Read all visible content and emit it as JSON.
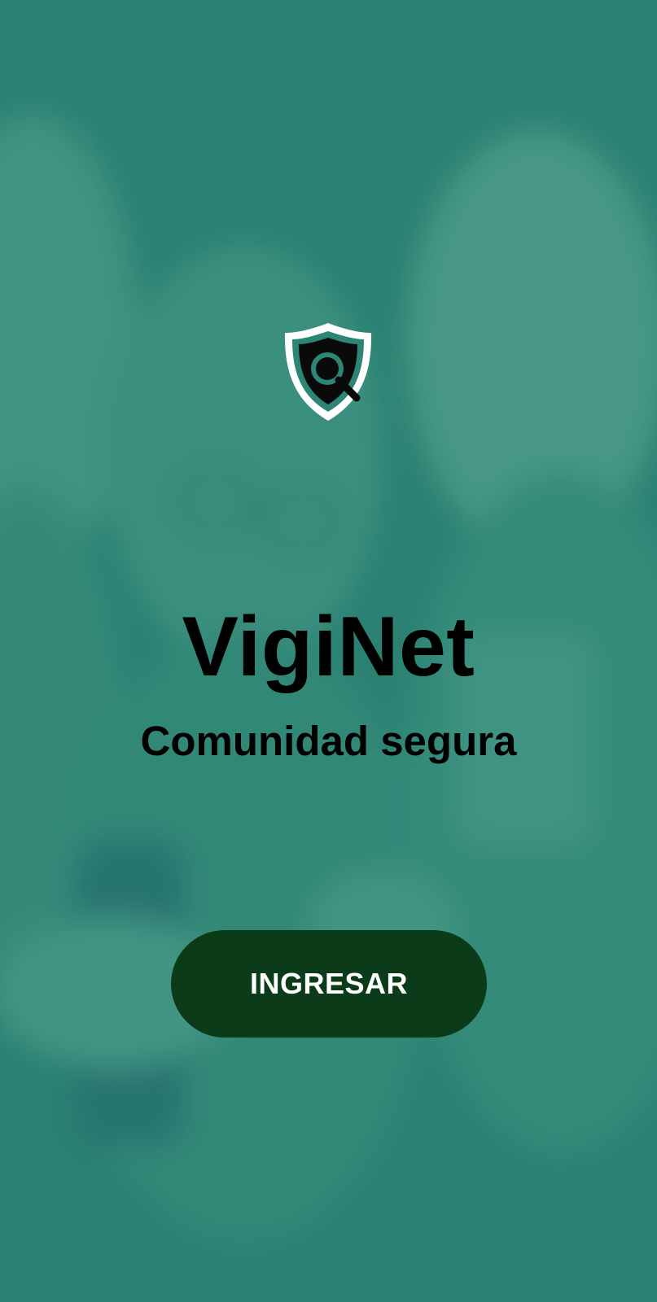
{
  "app": {
    "name": "VigiNet",
    "tagline": "Comunidad segura"
  },
  "actions": {
    "enter_label": "INGRESAR"
  },
  "icons": {
    "logo": "shield-search-icon"
  },
  "colors": {
    "background_overlay": "#2c8676",
    "button_background": "#0b3b18",
    "button_text": "#ffffff",
    "title_text": "#000000"
  }
}
